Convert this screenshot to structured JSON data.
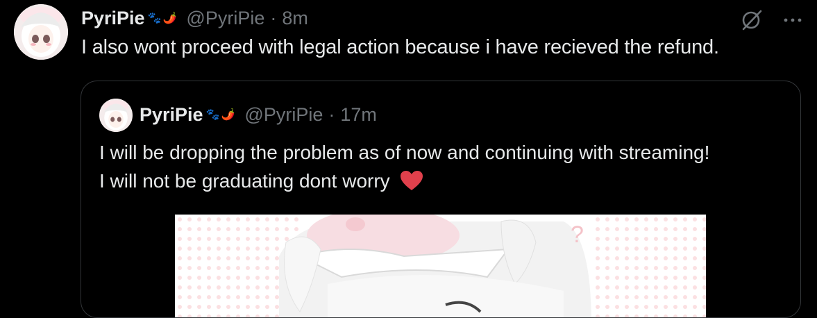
{
  "post": {
    "display_name": "PyriPie",
    "emoji_paws": "🐾",
    "emoji_pepper": "🌶️",
    "handle": "@PyriPie",
    "separator": "·",
    "time": "8m",
    "text": "I also wont proceed with legal action because i have recieved the refund.",
    "icons": {
      "grok": "grok-icon",
      "more": "more-icon"
    }
  },
  "quote": {
    "display_name": "PyriPie",
    "emoji_paws": "🐾",
    "emoji_pepper": "🌶️",
    "handle": "@PyriPie",
    "separator": "·",
    "time": "17m",
    "text_line1": "I will be dropping the problem as of now and continuing with streaming!",
    "text_line2": "I will not be graduating dont worry",
    "heart_emoji": "❤️"
  },
  "colors": {
    "background": "#000000",
    "text_primary": "#e7e9ea",
    "text_secondary": "#71767b",
    "border": "#333639",
    "heart": "#f0434a"
  }
}
